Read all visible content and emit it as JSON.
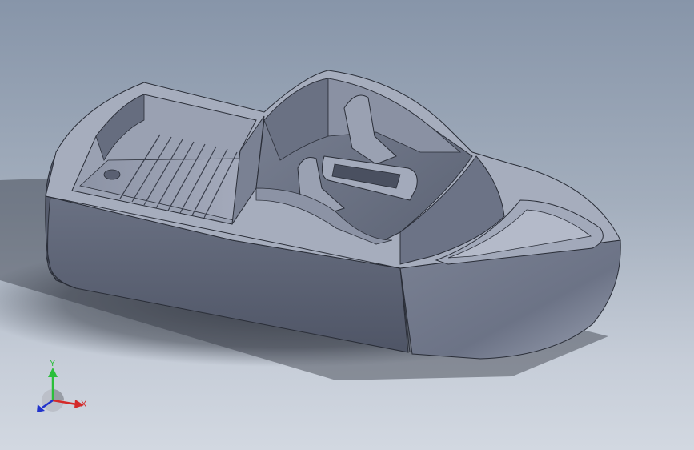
{
  "viewport": {
    "model_name": "",
    "background_top": "#8795a9",
    "background_bottom": "#d2d8e1",
    "model_color": "#5f6678"
  },
  "triad": {
    "x_label": "X",
    "y_label": "Y",
    "x_color": "#d42a2a",
    "y_color": "#2bbf3a",
    "z_color": "#2233cc"
  }
}
